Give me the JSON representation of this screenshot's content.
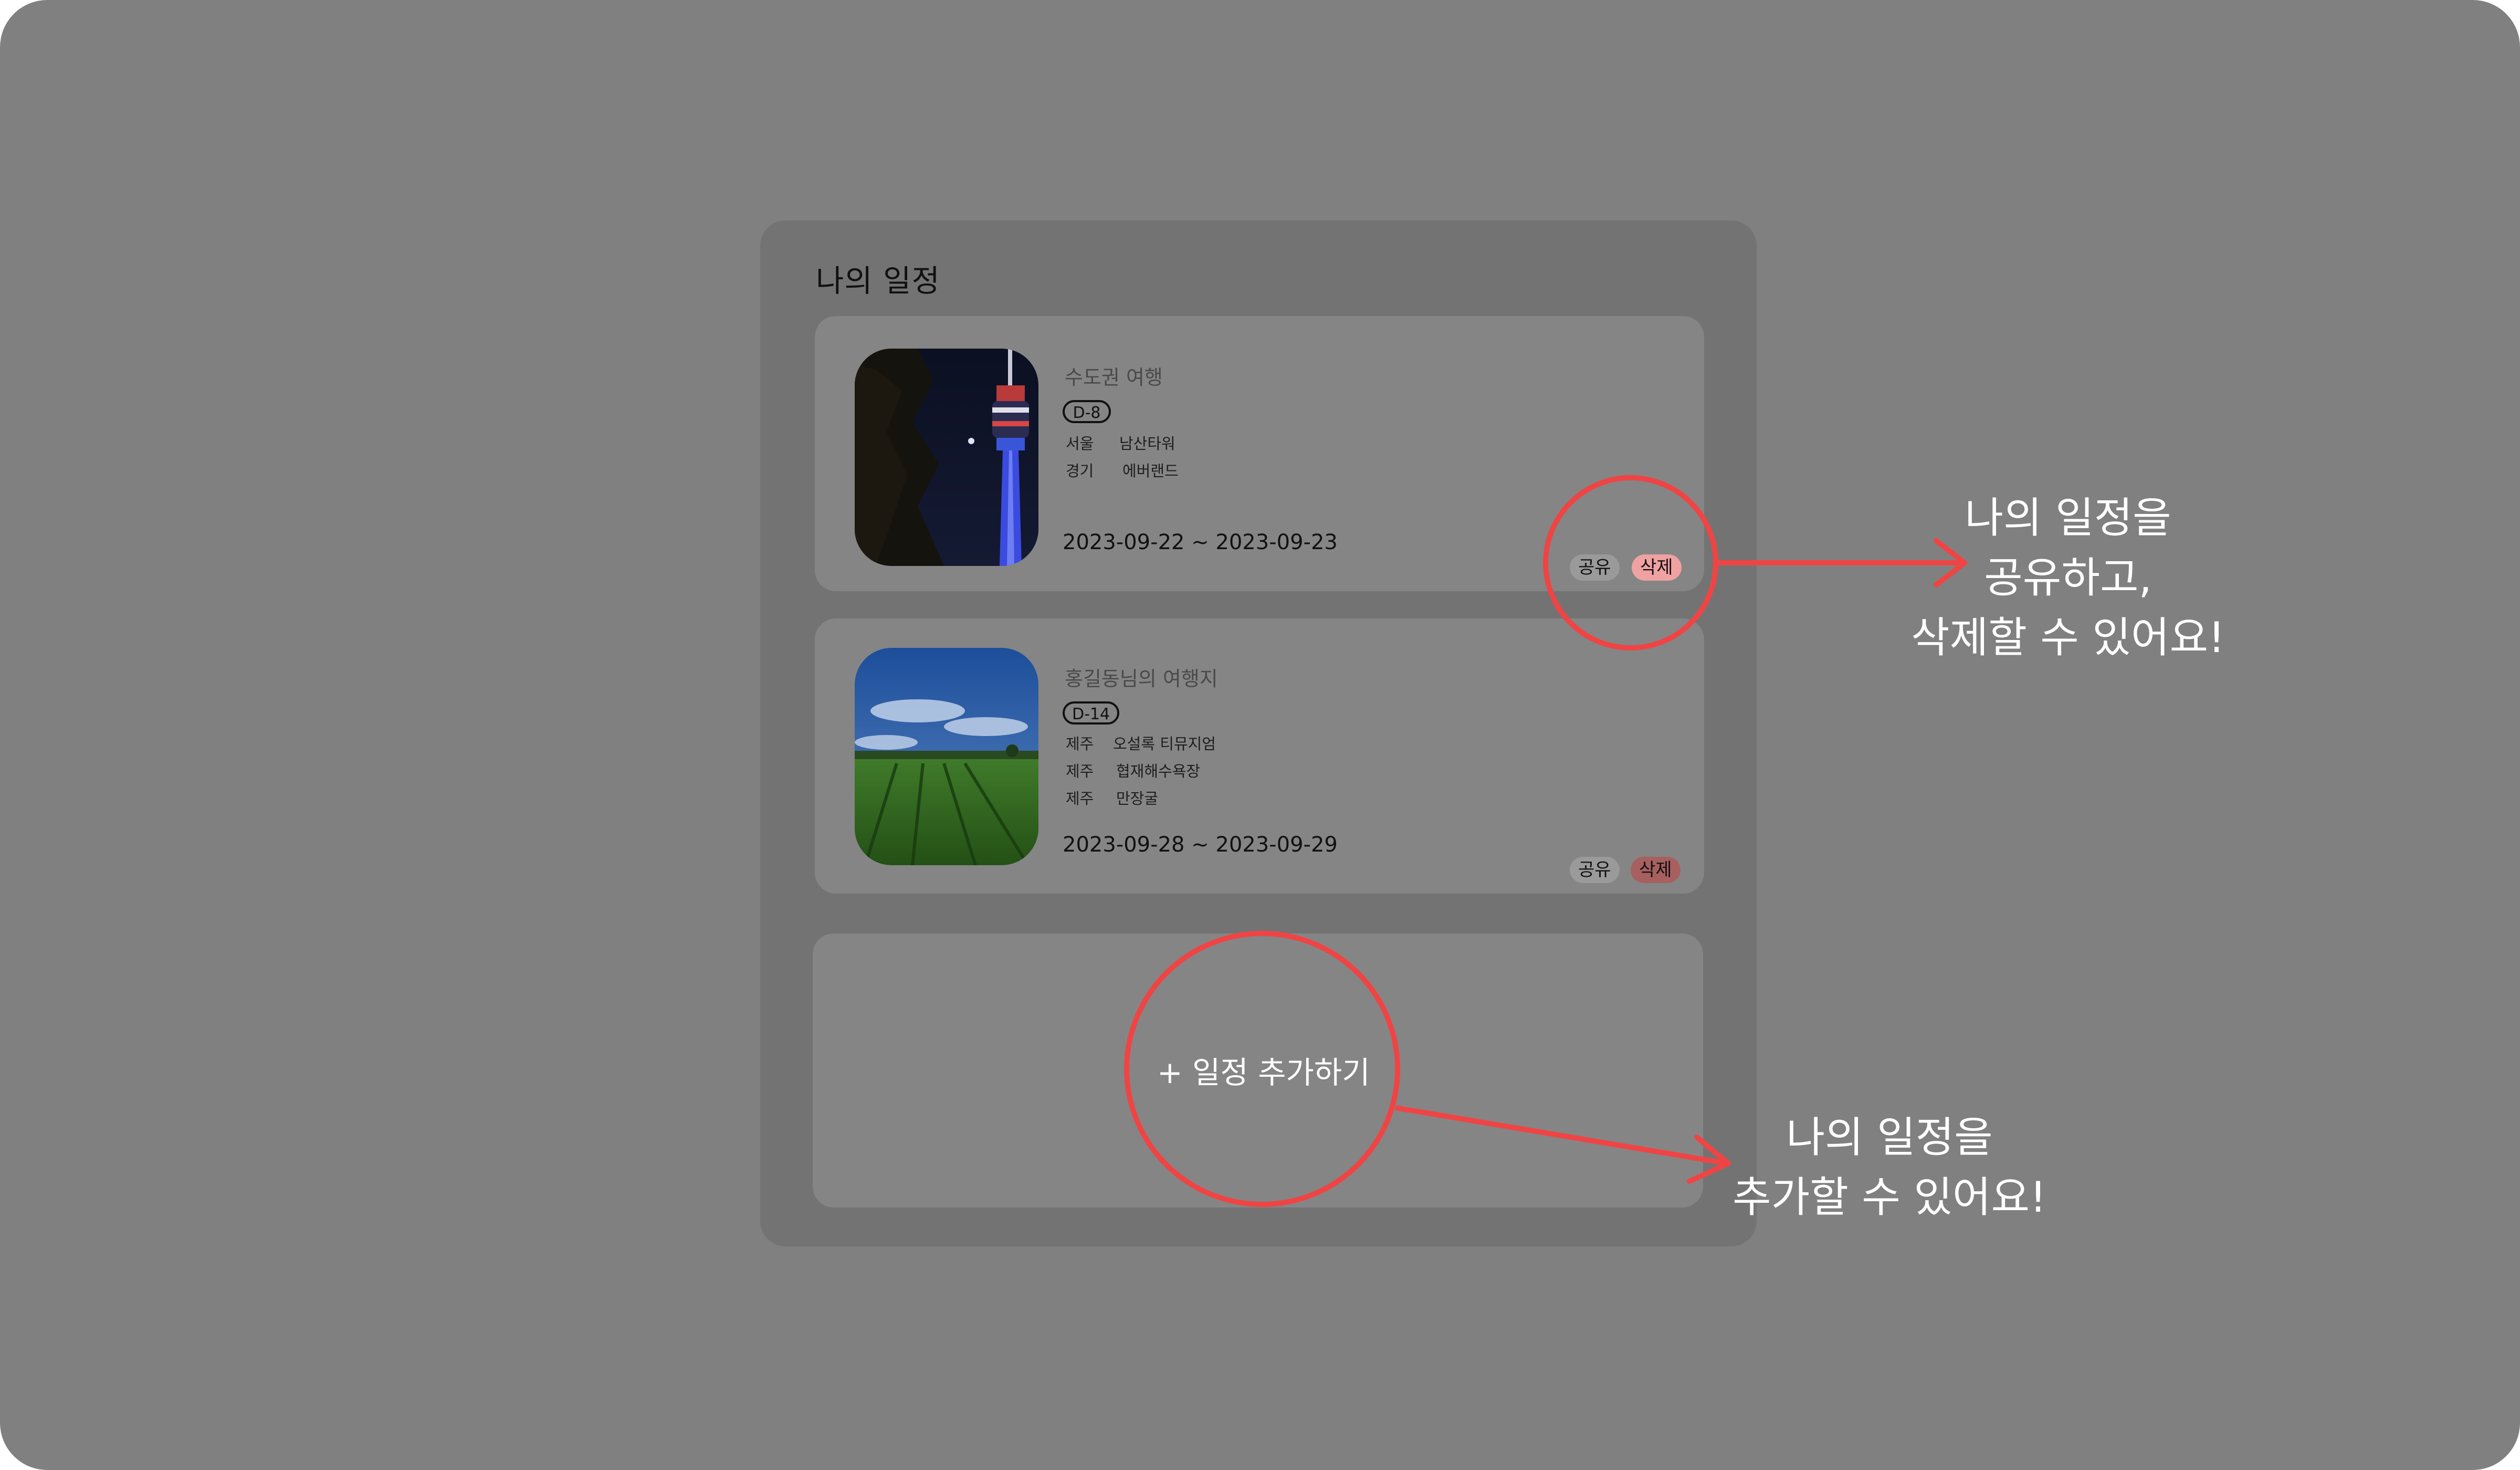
{
  "panel": {
    "title": "나의 일정"
  },
  "trips": [
    {
      "title": "수도권 여행",
      "dday": "D-8",
      "places": [
        {
          "region": "서울",
          "name": "남산타워"
        },
        {
          "region": "경기",
          "name": "에버랜드"
        }
      ],
      "date_range": "2023-09-22 ~ 2023-09-23",
      "share_label": "공유",
      "delete_label": "삭제"
    },
    {
      "title": "홍길동님의 여행지",
      "dday": "D-14",
      "places": [
        {
          "region": "제주",
          "name": "오설록 티뮤지엄"
        },
        {
          "region": "제주",
          "name": "협재해수욕장"
        },
        {
          "region": "제주",
          "name": "만장굴"
        }
      ],
      "date_range": "2023-09-28 ~ 2023-09-29",
      "share_label": "공유",
      "delete_label": "삭제"
    }
  ],
  "add_card": {
    "label": "+ 일정 추가하기"
  },
  "callouts": {
    "share_delete": [
      "나의 일정을",
      "공유하고,",
      "삭제할 수 있어요!"
    ],
    "add": [
      "나의 일정을",
      "추가할 수 있어요!"
    ]
  },
  "colors": {
    "background": "#808080",
    "panel": "#737373",
    "card": "#858585",
    "highlight": "#f04444",
    "delete_tag": "#f0a1a1"
  }
}
